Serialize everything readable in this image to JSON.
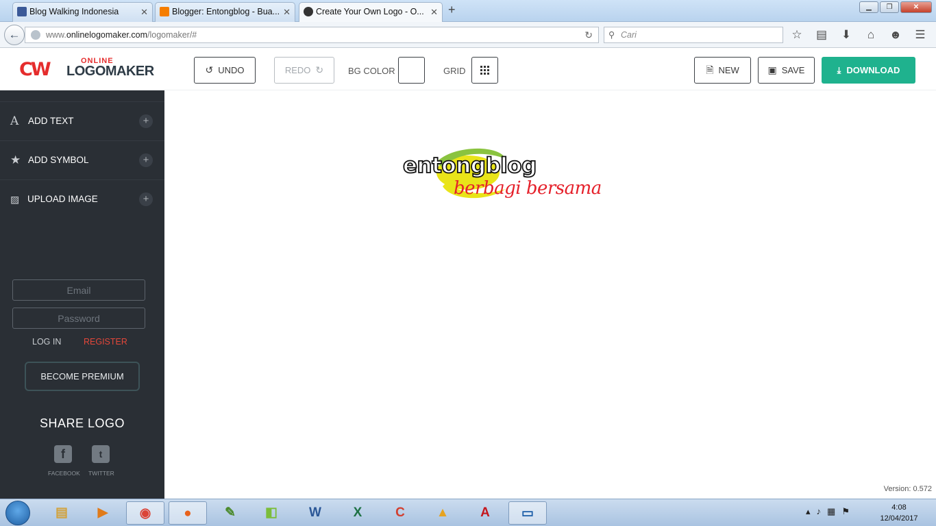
{
  "browser": {
    "tabs": [
      {
        "label": "Blog Walking Indonesia",
        "favicon_color": "#3b5998"
      },
      {
        "label": "Blogger: Entongblog - Bua...",
        "favicon_color": "#f57d00"
      },
      {
        "label": "Create Your Own Logo - O...",
        "favicon_color": "#333333"
      }
    ],
    "url_prefix": "www.",
    "url_domain": "onlinelogomaker.com",
    "url_path": "/logomaker/#",
    "search_placeholder": "Cari"
  },
  "app": {
    "logo_cw": "CW",
    "logo_online": "ONLINE",
    "logo_text": "LOGOMAKER",
    "toolbar": {
      "undo": "UNDO",
      "redo": "REDO",
      "bg_color": "BG COLOR",
      "grid": "GRID",
      "new": "NEW",
      "save": "SAVE",
      "download": "DOWNLOAD"
    },
    "accent_color": "#1fb28e"
  },
  "sidebar": {
    "items": [
      {
        "label": "ADD TEXT",
        "icon": "text-icon"
      },
      {
        "label": "ADD SYMBOL",
        "icon": "star-icon"
      },
      {
        "label": "UPLOAD IMAGE",
        "icon": "image-icon"
      }
    ],
    "email_placeholder": "Email",
    "password_placeholder": "Password",
    "login": "LOG IN",
    "register": "REGISTER",
    "premium": "BECOME PREMIUM",
    "share_title": "SHARE LOGO",
    "facebook": "FACEBOOK",
    "twitter": "TWITTER"
  },
  "canvas": {
    "logo_main": "entongblog",
    "logo_sub": "berbagi bersama",
    "version": "Version: 0.572"
  },
  "taskbar": {
    "time": "4:08",
    "date": "12/04/2017"
  }
}
